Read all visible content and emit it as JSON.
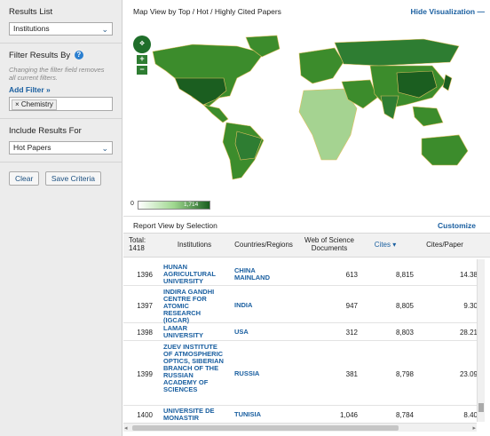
{
  "sidebar": {
    "results_list": {
      "title": "Results List",
      "value": "Institutions"
    },
    "filter": {
      "title": "Filter Results By",
      "help": "?",
      "note": "Changing the filter field removes all current filters.",
      "add_filter": "Add Filter »",
      "chip": "× Chemistry"
    },
    "include": {
      "title": "Include Results For",
      "value": "Hot Papers"
    },
    "buttons": {
      "clear": "Clear",
      "save": "Save Criteria"
    }
  },
  "map": {
    "title": "Map View by Top / Hot / Highly Cited Papers",
    "hide_label": "Hide Visualization —",
    "legend_min": "0",
    "legend_max": "1,714",
    "colors": {
      "land_dark": "#1b5e20",
      "land_mid": "#3c8c2c",
      "land_light": "#a5d391",
      "ocean": "#ffffff"
    }
  },
  "report": {
    "title": "Report View by Selection",
    "customize": "Customize"
  },
  "table": {
    "headers": {
      "total": "Total:",
      "total_count": "1418",
      "institutions": "Institutions",
      "countries": "Countries/Regions",
      "docs_line1": "Web of Science",
      "docs_line2": "Documents",
      "cites": "Cites ▾",
      "cites_per_paper": "Cites/Paper"
    },
    "rows": [
      {
        "rank": "1396",
        "inst": "HUNAN AGRICULTURAL UNIVERSITY",
        "country": "CHINA MAINLAND",
        "docs": "613",
        "cites": "8,815",
        "cpp": "14.38"
      },
      {
        "rank": "1397",
        "inst": "INDIRA GANDHI CENTRE FOR ATOMIC RESEARCH (IGCAR)",
        "country": "INDIA",
        "docs": "947",
        "cites": "8,805",
        "cpp": "9.30"
      },
      {
        "rank": "1398",
        "inst": "LAMAR UNIVERSITY",
        "country": "USA",
        "docs": "312",
        "cites": "8,803",
        "cpp": "28.21"
      },
      {
        "rank": "1399",
        "inst": "ZUEV INSTITUTE OF ATMOSPHERIC OPTICS, SIBERIAN BRANCH OF THE RUSSIAN ACADEMY OF SCIENCES",
        "country": "RUSSIA",
        "docs": "381",
        "cites": "8,798",
        "cpp": "23.09"
      },
      {
        "rank": "1400",
        "inst": "UNIVERSITE DE MONASTIR",
        "country": "TUNISIA",
        "docs": "1,046",
        "cites": "8,784",
        "cpp": "8.40"
      }
    ]
  }
}
